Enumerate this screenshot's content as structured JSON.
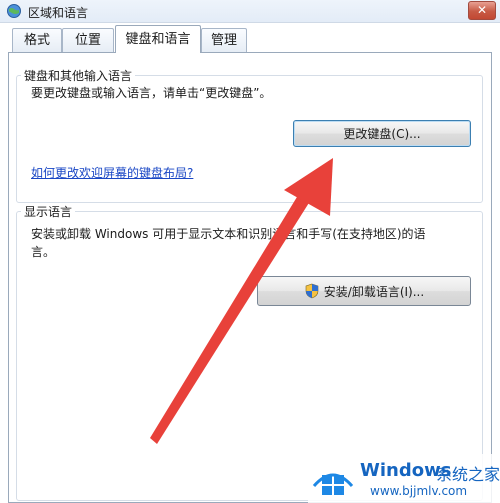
{
  "window": {
    "title": "区域和语言",
    "close_glyph": "✕"
  },
  "tabs": [
    {
      "label": "格式",
      "active": false
    },
    {
      "label": "位置",
      "active": false
    },
    {
      "label": "键盘和语言",
      "active": true
    },
    {
      "label": "管理",
      "active": false
    }
  ],
  "keyboard_group": {
    "legend": "键盘和其他输入语言",
    "description": "要更改键盘或输入语言，请单击“更改键盘”。",
    "change_keyboard_button": "更改键盘(C)...",
    "help_link": "如何更改欢迎屏幕的键盘布局?"
  },
  "display_group": {
    "legend": "显示语言",
    "description_line1": "安装或卸载 Windows 可用于显示文本和识别语言和手写(在支持地区)的语",
    "description_line2": "言。",
    "install_button": "安装/卸载语言(I)..."
  },
  "annotation": {
    "arrow_color": "#e8413a"
  },
  "watermark": {
    "brand": "Windows",
    "site_name": "系统之家",
    "url": "www.bjjmlv.com"
  }
}
